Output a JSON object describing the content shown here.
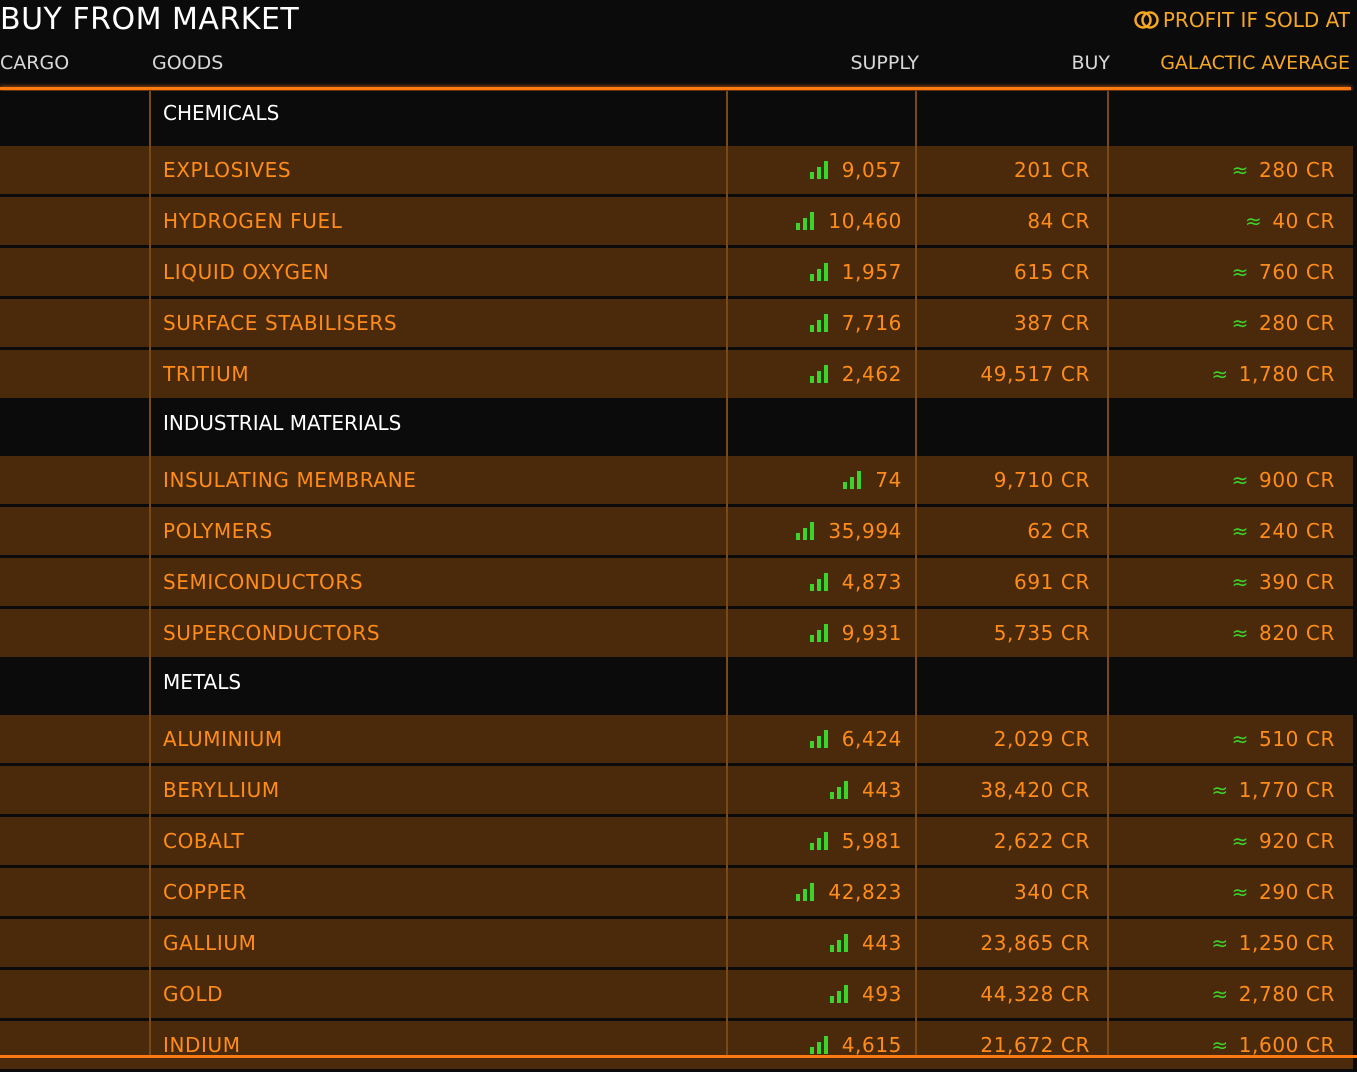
{
  "title": "BUY FROM MARKET",
  "profit_label": "PROFIT IF SOLD AT",
  "columns": {
    "cargo": "CARGO",
    "goods": "GOODS",
    "supply": "SUPPLY",
    "buy": "BUY",
    "galactic": "GALACTIC AVERAGE"
  },
  "colors": {
    "accent": "#ff8c1a",
    "row_bg": "#4a2a0b",
    "supply_bars": "#3cd42a",
    "background": "#0b0b0c"
  },
  "approx_symbol": "≈",
  "categories": [
    {
      "name": "CHEMICALS",
      "items": [
        {
          "name": "EXPLOSIVES",
          "supply": "9,057",
          "buy": "201 CR",
          "galactic": "280 CR"
        },
        {
          "name": "HYDROGEN FUEL",
          "supply": "10,460",
          "buy": "84 CR",
          "galactic": "40 CR"
        },
        {
          "name": "LIQUID OXYGEN",
          "supply": "1,957",
          "buy": "615 CR",
          "galactic": "760 CR"
        },
        {
          "name": "SURFACE STABILISERS",
          "supply": "7,716",
          "buy": "387 CR",
          "galactic": "280 CR"
        },
        {
          "name": "TRITIUM",
          "supply": "2,462",
          "buy": "49,517 CR",
          "galactic": "1,780 CR"
        }
      ]
    },
    {
      "name": "INDUSTRIAL MATERIALS",
      "items": [
        {
          "name": "INSULATING MEMBRANE",
          "supply": "74",
          "buy": "9,710 CR",
          "galactic": "900 CR"
        },
        {
          "name": "POLYMERS",
          "supply": "35,994",
          "buy": "62 CR",
          "galactic": "240 CR"
        },
        {
          "name": "SEMICONDUCTORS",
          "supply": "4,873",
          "buy": "691 CR",
          "galactic": "390 CR"
        },
        {
          "name": "SUPERCONDUCTORS",
          "supply": "9,931",
          "buy": "5,735 CR",
          "galactic": "820 CR"
        }
      ]
    },
    {
      "name": "METALS",
      "items": [
        {
          "name": "ALUMINIUM",
          "supply": "6,424",
          "buy": "2,029 CR",
          "galactic": "510 CR"
        },
        {
          "name": "BERYLLIUM",
          "supply": "443",
          "buy": "38,420 CR",
          "galactic": "1,770 CR"
        },
        {
          "name": "COBALT",
          "supply": "5,981",
          "buy": "2,622 CR",
          "galactic": "920 CR"
        },
        {
          "name": "COPPER",
          "supply": "42,823",
          "buy": "340 CR",
          "galactic": "290 CR"
        },
        {
          "name": "GALLIUM",
          "supply": "443",
          "buy": "23,865 CR",
          "galactic": "1,250 CR"
        },
        {
          "name": "GOLD",
          "supply": "493",
          "buy": "44,328 CR",
          "galactic": "2,780 CR"
        },
        {
          "name": "INDIUM",
          "supply": "4,615",
          "buy": "21,672 CR",
          "galactic": "1,600 CR"
        }
      ]
    }
  ]
}
